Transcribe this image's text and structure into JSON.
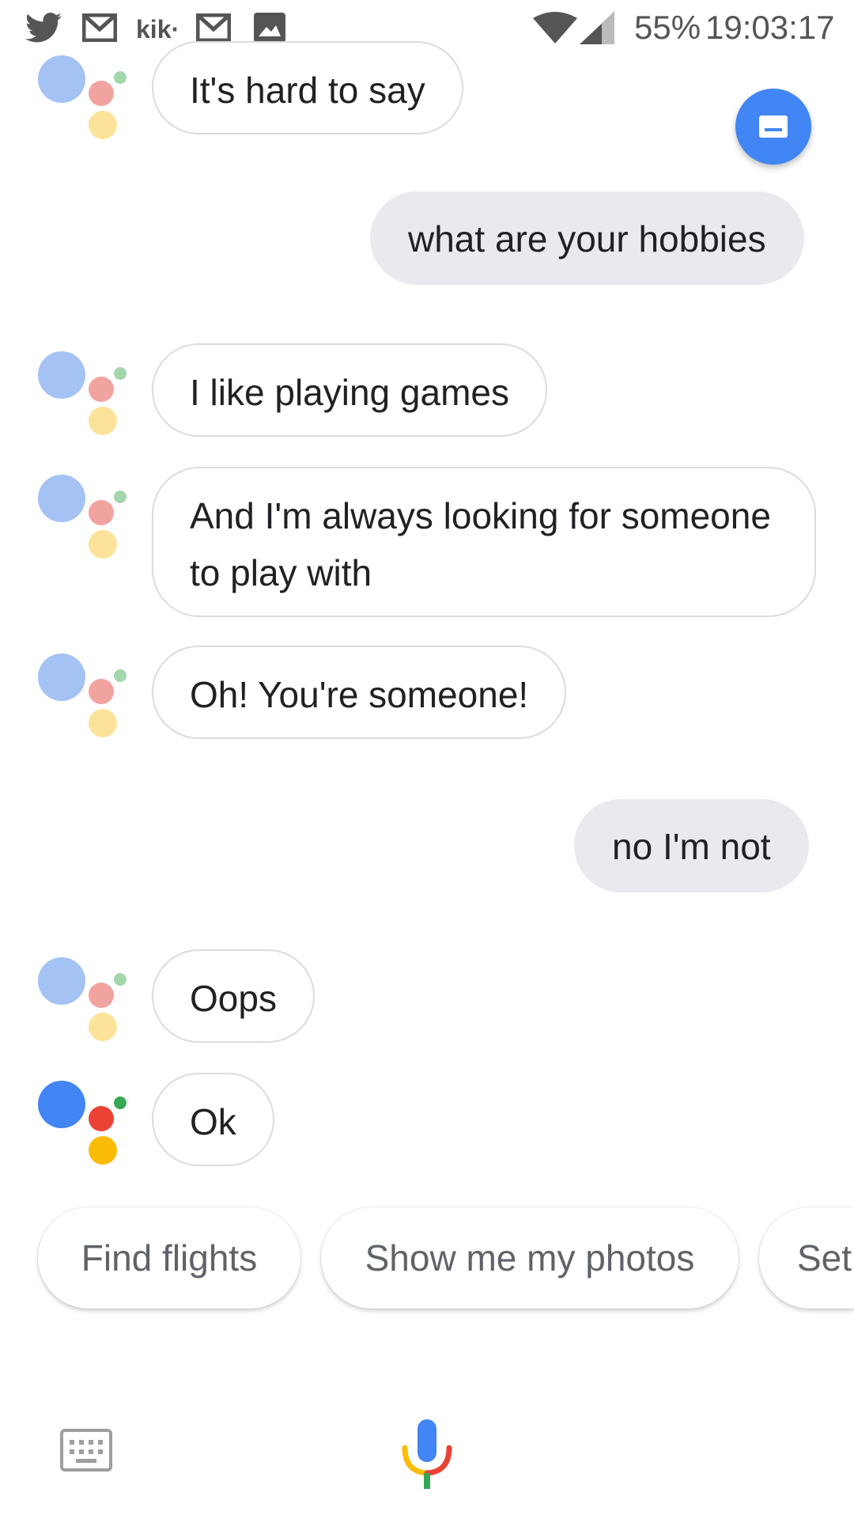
{
  "status_bar": {
    "battery": "55%",
    "time": "19:03:17",
    "notification_icons": [
      "twitter-icon",
      "gmail-icon",
      "kik-icon",
      "gmail-icon",
      "gallery-icon"
    ],
    "kik_label": "kik·"
  },
  "conversation": {
    "messages": [
      {
        "from": "assistant",
        "text": "It's hard to say"
      },
      {
        "from": "user",
        "text": "what are your hobbies"
      },
      {
        "from": "assistant",
        "text": "I like playing games"
      },
      {
        "from": "assistant",
        "text": "And I'm always looking for someone to play with"
      },
      {
        "from": "assistant",
        "text": "Oh! You're someone!"
      },
      {
        "from": "user",
        "text": "no I'm not"
      },
      {
        "from": "assistant",
        "text": "Oops"
      },
      {
        "from": "assistant",
        "text": "Ok"
      }
    ]
  },
  "suggestions": [
    "Find flights",
    "Show me my photos",
    "Set"
  ],
  "colors": {
    "blue": "#4285f4",
    "red": "#ea4335",
    "yellow": "#fbbc05",
    "green": "#34a853",
    "user_bubble": "#e8eaed"
  }
}
